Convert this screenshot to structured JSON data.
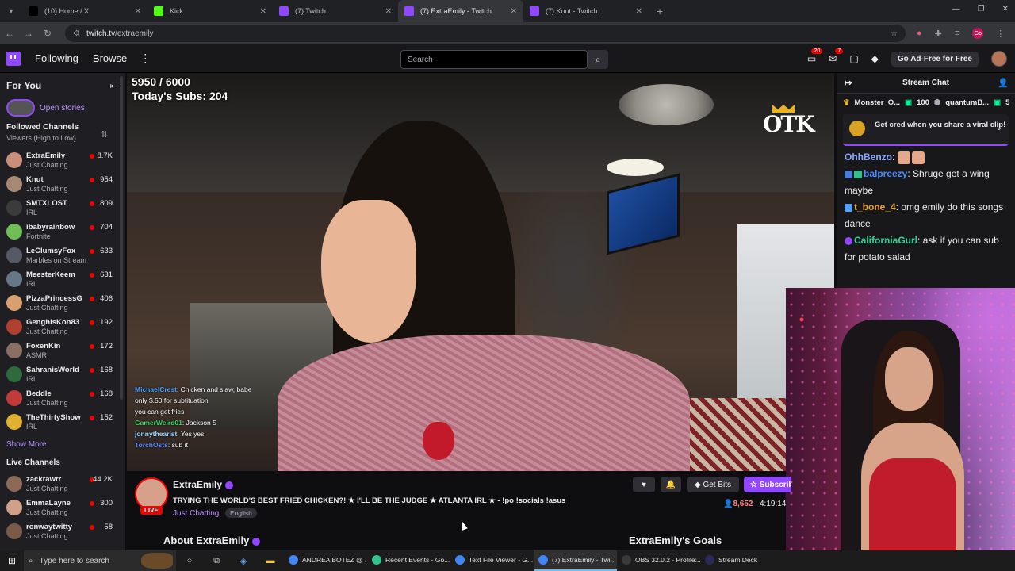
{
  "browser": {
    "tabs": [
      {
        "title": "(10) Home / X",
        "color": "#000000",
        "active": false
      },
      {
        "title": "Kick",
        "color": "#53fc18",
        "active": false
      },
      {
        "title": "(7) Twitch",
        "color": "#9147ff",
        "active": false
      },
      {
        "title": "(7) ExtraEmily - Twitch",
        "color": "#9147ff",
        "active": true
      },
      {
        "title": "(7) Knut - Twitch",
        "color": "#9147ff",
        "active": false
      }
    ],
    "url_host": "twitch.tv",
    "url_path": "/extraemily",
    "profile_initials": "Go"
  },
  "topnav": {
    "following": "Following",
    "browse": "Browse",
    "search_placeholder": "Search",
    "notifications_count": "20",
    "inbox_count": "7",
    "ad_free": "Go Ad-Free for Free"
  },
  "sidebar": {
    "for_you": "For You",
    "open_stories": "Open stories",
    "followed_title": "Followed Channels",
    "followed_sort": "Viewers (High to Low)",
    "followed": [
      {
        "name": "ExtraEmily",
        "game": "Just Chatting",
        "viewers": "8.7K",
        "color": "#c98f7b"
      },
      {
        "name": "Knut",
        "game": "Just Chatting",
        "viewers": "954",
        "color": "#a88a74"
      },
      {
        "name": "SMTXLOST",
        "game": "IRL",
        "viewers": "809",
        "color": "#3b3b3b"
      },
      {
        "name": "ibabyrainbow",
        "game": "Fortnite",
        "viewers": "704",
        "color": "#6fbf56"
      },
      {
        "name": "LeClumsyFox",
        "game": "Marbles on Stream",
        "viewers": "633",
        "color": "#555a66"
      },
      {
        "name": "MeesterKeem",
        "game": "IRL",
        "viewers": "631",
        "color": "#667788"
      },
      {
        "name": "PizzaPrincessG",
        "game": "Just Chatting",
        "viewers": "406",
        "color": "#d8a070"
      },
      {
        "name": "GenghisKon83",
        "game": "Just Chatting",
        "viewers": "192",
        "color": "#b04030"
      },
      {
        "name": "FoxenKin",
        "game": "ASMR",
        "viewers": "172",
        "color": "#8a6f63"
      },
      {
        "name": "SahranisWorld",
        "game": "IRL",
        "viewers": "168",
        "color": "#2e6a3c"
      },
      {
        "name": "Beddle",
        "game": "Just Chatting",
        "viewers": "168",
        "color": "#c23b3b"
      },
      {
        "name": "TheThirtyShow",
        "game": "IRL",
        "viewers": "152",
        "color": "#e0b030"
      }
    ],
    "show_more": "Show More",
    "live_title": "Live Channels",
    "live": [
      {
        "name": "zackrawrr",
        "game": "Just Chatting",
        "viewers": "44.2K",
        "color": "#8c6a58"
      },
      {
        "name": "EmmaLayne",
        "game": "Just Chatting",
        "viewers": "300",
        "color": "#d1a089"
      },
      {
        "name": "ronwaytwitty",
        "game": "Just Chatting",
        "viewers": "58",
        "color": "#7a5a48"
      }
    ]
  },
  "video": {
    "sub_goal": "5950 / 6000",
    "today_subs": "Today's Subs: 204",
    "logo": "OTK",
    "overlay_chat": [
      {
        "user": "MichaelCrest",
        "text": "Chicken and slaw, babe",
        "color": "#4ea3ff"
      },
      {
        "user": "",
        "text": "only $.50 for subtituation",
        "color": "#ff5050"
      },
      {
        "user": "",
        "text": "you can get fries",
        "color": "#ff9a4a"
      },
      {
        "user": "GamerWeird01",
        "text": "Jackson 5",
        "color": "#37d36b"
      },
      {
        "user": "jonnythearist",
        "text": "Yes yes",
        "color": "#9bd7ff"
      },
      {
        "user": "TorchOsts",
        "text": "sub it",
        "color": "#5b8cff"
      }
    ]
  },
  "chat": {
    "title": "Stream Chat",
    "leaders": [
      {
        "name": "Monster_O...",
        "amount": "100"
      },
      {
        "name": "quantumB...",
        "amount": "5"
      }
    ],
    "cred_text": "Get cred when you share a viral clip!",
    "messages": [
      {
        "user": "OhhBenzo",
        "text": "",
        "color": "#8aa6ff"
      },
      {
        "user": "balpreezy",
        "text": "Shruge get a wing maybe",
        "color": "#4b8cff"
      },
      {
        "user": "t_bone_4",
        "text": "omg emily do this songs dance",
        "color": "#e6a22a"
      },
      {
        "user": "CaliforniaGurl",
        "text": "ask if you can sub for potato salad",
        "color": "#2fd596"
      }
    ]
  },
  "stream": {
    "name": "ExtraEmily",
    "live": "LIVE",
    "title": "TRYING THE WORLD'S BEST FRIED CHICKEN?! ★ I'LL BE THE JUDGE ★ ATLANTA IRL ★ - !po !socials !asus",
    "category": "Just Chatting",
    "tag": "English",
    "get_bits": "Get Bits",
    "subscribe": "Subscribe",
    "viewers": "8,652",
    "uptime": "4:19:14",
    "about": "About ExtraEmily",
    "goals": "ExtraEmily's Goals"
  },
  "taskbar": {
    "search_placeholder": "Type here to search",
    "apps": [
      {
        "label": "ANDREA BOTEZ @ ...",
        "color": "#4285f4",
        "active": false
      },
      {
        "label": "Recent Events - Go...",
        "color": "#31c48d",
        "active": false
      },
      {
        "label": "Text File Viewer - G...",
        "color": "#4285f4",
        "active": false
      },
      {
        "label": "(7) ExtraEmily - Twi...",
        "color": "#4285f4",
        "active": true
      },
      {
        "label": "OBS 32.0.2 - Profile:...",
        "color": "#3a3a3a",
        "active": false
      },
      {
        "label": "Stream Deck",
        "color": "#2a2a5a",
        "active": false
      }
    ]
  }
}
